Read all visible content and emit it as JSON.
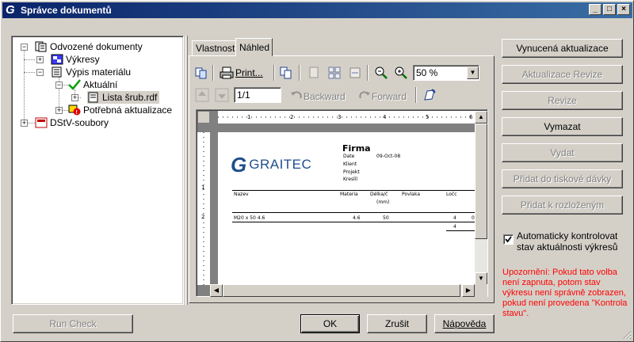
{
  "window": {
    "title": "Správce dokumentů"
  },
  "tree": {
    "items": [
      {
        "label": "Odvozené dokumenty"
      },
      {
        "label": "Výkresy"
      },
      {
        "label": "Výpis materiálu"
      },
      {
        "label": "Aktuální"
      },
      {
        "label": "Lista šrub.rdf"
      },
      {
        "label": "Potřebná aktualizace"
      },
      {
        "label": "DStV-soubory"
      }
    ]
  },
  "tabs": [
    {
      "label": "Vlastnosti"
    },
    {
      "label": "Náhled"
    }
  ],
  "toolbar": {
    "print_label": "Print...",
    "zoom_value": "50 %",
    "page_value": "1/1",
    "backward_label": "Backward",
    "forward_label": "Forward"
  },
  "preview": {
    "logo_text": "GRAITEC",
    "firma": "Firma",
    "date_label": "Date",
    "date_value": "09-Oct-08",
    "klient": "Klient",
    "projekt": "Projekt",
    "kreslil": "Kreslil",
    "col_nazev": "Nazev",
    "col_materia": "Materia",
    "col_delka": "Délka/č",
    "col_unit": "(mm)",
    "col_povlak": "Povlaka",
    "col_pocet": "Ločc",
    "row_name": "M20 x 50 4.6",
    "row_mat": "4.6",
    "row_len": "50",
    "row_cnt": "4",
    "row_last": "0",
    "total": "4",
    "ruler_marks": [
      "1",
      "2",
      "3",
      "4",
      "5",
      "6"
    ],
    "vruler_marks": [
      "1",
      "2"
    ]
  },
  "buttons": {
    "forced_update": "Vynucená aktualizace",
    "update_revision": "Aktualizace Revize",
    "revision": "Revize",
    "delete": "Vymazat",
    "issue": "Vydat",
    "add_print_batch": "Přidat do tiskové dávky",
    "add_layout": "Přidat k rozloženým",
    "run_check": "Run Check",
    "ok": "OK",
    "cancel": "Zrušit",
    "help": "Nápověda"
  },
  "auto_check": {
    "checked": true,
    "label_line1": "Automaticky kontrolovat",
    "label_line2": "stav aktuálnosti výkresů"
  },
  "warning": "Upozornění: Pokud tato volba není zapnuta, potom stav výkresu není správně zobrazen, pokud není provedena \"Kontrola stavu\"."
}
